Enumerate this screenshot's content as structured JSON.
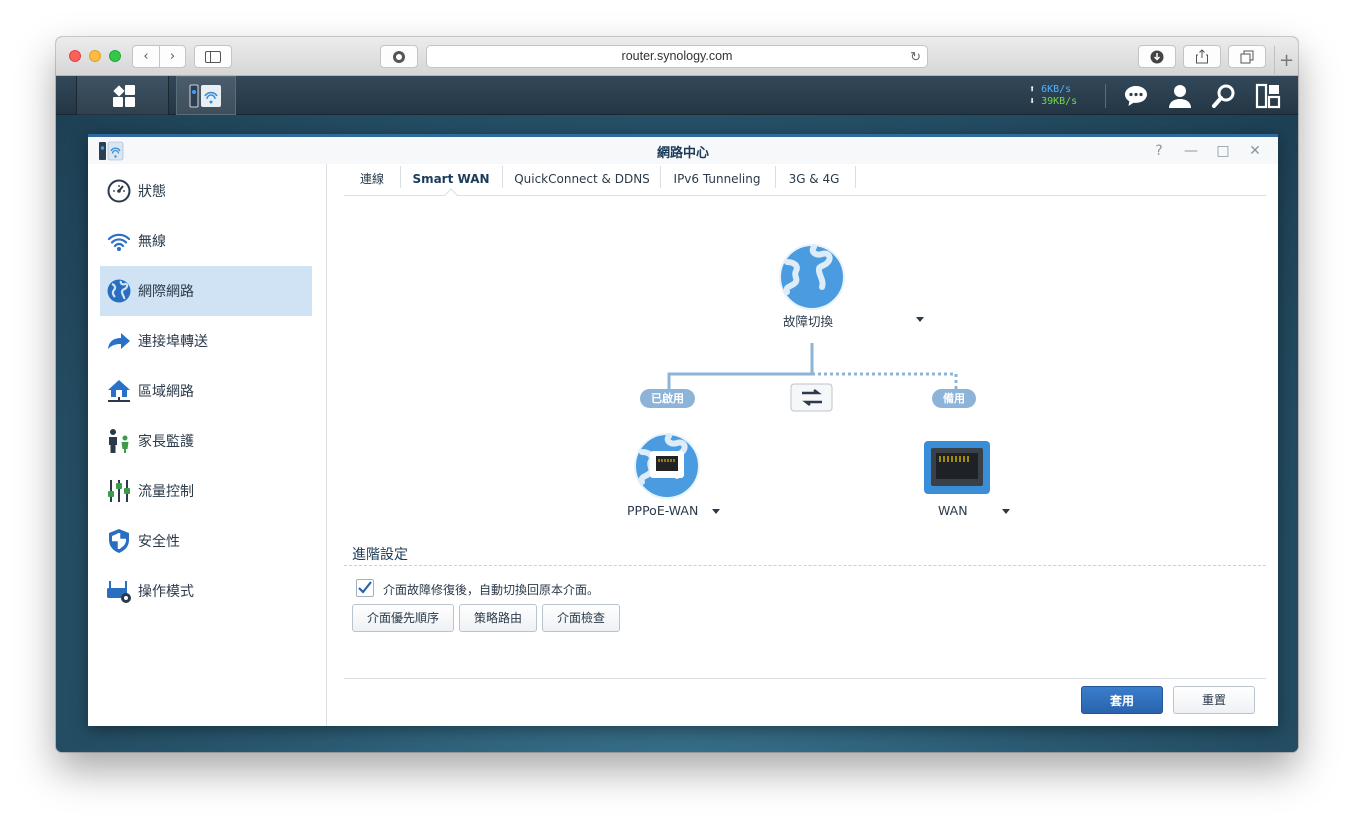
{
  "browser": {
    "url": "router.synology.com"
  },
  "taskbar": {
    "upload_speed": "6KB/s",
    "download_speed": "39KB/s"
  },
  "window": {
    "title": "網路中心",
    "help": "?",
    "minimize": "—",
    "maximize": "□",
    "close": "✕"
  },
  "sidebar": {
    "items": [
      {
        "label": "狀態",
        "icon": "gauge-icon"
      },
      {
        "label": "無線",
        "icon": "wifi-icon"
      },
      {
        "label": "網際網路",
        "icon": "globe-icon",
        "active": true
      },
      {
        "label": "連接埠轉送",
        "icon": "forward-arrow-icon"
      },
      {
        "label": "區域網路",
        "icon": "home-network-icon"
      },
      {
        "label": "家長監護",
        "icon": "family-icon"
      },
      {
        "label": "流量控制",
        "icon": "sliders-icon"
      },
      {
        "label": "安全性",
        "icon": "shield-icon"
      },
      {
        "label": "操作模式",
        "icon": "router-gear-icon"
      }
    ]
  },
  "tabs": [
    "連線",
    "Smart WAN",
    "QuickConnect & DDNS",
    "IPv6 Tunneling",
    "3G & 4G"
  ],
  "active_tab": "Smart WAN",
  "diagram": {
    "mode_label": "故障切換",
    "primary_badge": "已啟用",
    "backup_badge": "備用",
    "primary_label": "PPPoE-WAN",
    "backup_label": "WAN"
  },
  "advanced": {
    "title": "進階設定",
    "checkbox_label": "介面故障修復後，自動切換回原本介面。",
    "checkbox_checked": true,
    "buttons": [
      "介面優先順序",
      "策略路由",
      "介面檢查"
    ]
  },
  "footer": {
    "apply": "套用",
    "reset": "重置"
  },
  "colors": {
    "accent": "#2a63ad",
    "active_sidebar": "#cfe3f5",
    "badge": "#8db4d8",
    "line": "#8db4d8"
  }
}
